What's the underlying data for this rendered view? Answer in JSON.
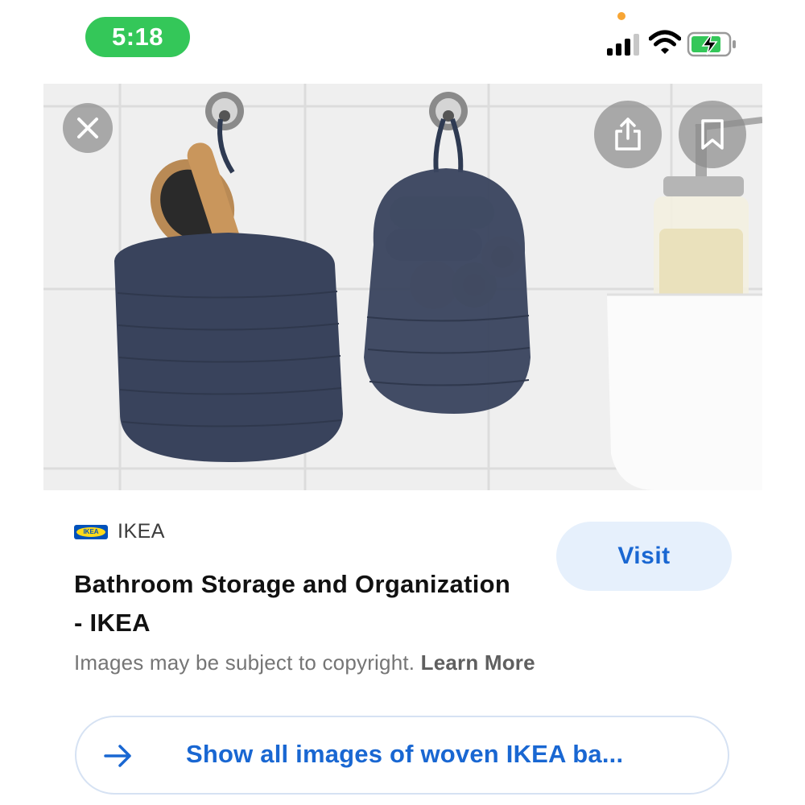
{
  "status_bar": {
    "time": "5:18",
    "icons": [
      "signal-icon",
      "wifi-icon",
      "battery-charging-icon"
    ]
  },
  "image": {
    "icons": [
      "close-icon",
      "share-icon",
      "bookmark-icon"
    ]
  },
  "result": {
    "source_name": "IKEA",
    "source_logo_text": "IKEA",
    "title": "Bathroom Storage and Organization - IKEA",
    "visit_label": "Visit",
    "copyright_text": "Images may be subject to copyright.",
    "learn_more": "Learn More"
  },
  "show_all": {
    "label": "Show all images of woven IKEA ba...",
    "icon": "arrow-right-icon"
  },
  "colors": {
    "accent": "#1967d2",
    "time_pill": "#34c759",
    "visit_bg": "#e6f0fc"
  }
}
